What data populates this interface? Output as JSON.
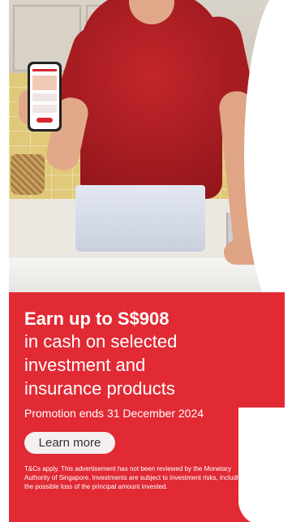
{
  "ad": {
    "headline": "Earn up to S$908",
    "subline": [
      "in cash on selected",
      "investment and",
      "insurance products"
    ],
    "promotion_end": "Promotion ends 31 December 2024",
    "cta_label": "Learn more",
    "disclaimer": "T&Cs apply. This advertisement has not been reviewed by the Monetary Authority of Singapore. Investments are subject to investment risks, including the possible loss of the principal amount invested."
  },
  "colors": {
    "brand_red": "#e12a34",
    "button_bg": "#f4f0ef",
    "text_on_red": "#ffffff"
  }
}
